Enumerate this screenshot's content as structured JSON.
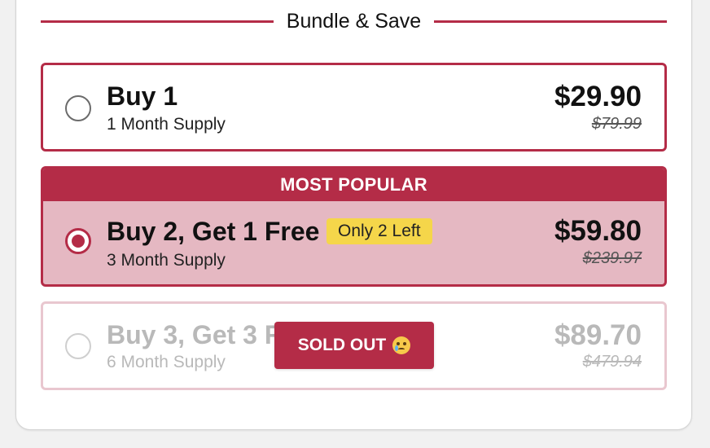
{
  "section": {
    "heading": "Bundle & Save"
  },
  "options": [
    {
      "title": "Buy 1",
      "subtitle": "1 Month Supply",
      "price": "$29.90",
      "compare_price": "$79.99",
      "selected": false,
      "sold_out": false
    },
    {
      "banner": "MOST POPULAR",
      "title": "Buy 2, Get 1 Free",
      "badge": "Only 2 Left",
      "subtitle": "3 Month Supply",
      "price": "$59.80",
      "compare_price": "$239.97",
      "selected": true,
      "sold_out": false
    },
    {
      "title": "Buy 3, Get 3 F",
      "subtitle": "6 Month Supply",
      "price": "$89.70",
      "compare_price": "$479.94",
      "selected": false,
      "sold_out": true,
      "sold_out_label": "SOLD OUT",
      "sold_out_icon": "crying-face-icon"
    }
  ],
  "colors": {
    "accent": "#b42c47",
    "selected_bg": "#e5b8c2",
    "badge_bg": "#f5d64a"
  }
}
